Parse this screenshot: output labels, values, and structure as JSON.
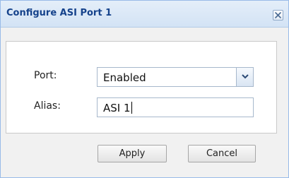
{
  "dialog": {
    "title": "Configure ASI Port 1",
    "close_icon": "close-icon"
  },
  "form": {
    "port": {
      "label": "Port:",
      "value": "Enabled",
      "trigger_icon": "chevron-down-icon"
    },
    "alias": {
      "label": "Alias:",
      "value": "ASI 1"
    }
  },
  "buttons": {
    "apply_label": "Apply",
    "cancel_label": "Cancel"
  },
  "colors": {
    "title_text": "#15428b",
    "titlebar_bg": "#dae7f6",
    "border": "#99bbe8",
    "body_bg": "#f1f1f1"
  }
}
